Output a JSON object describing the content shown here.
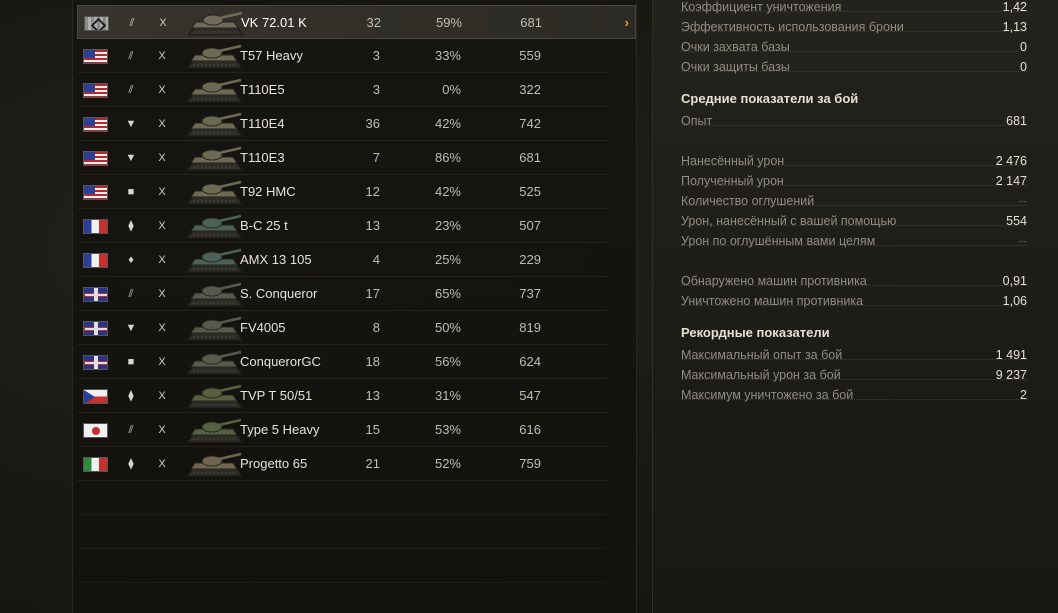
{
  "vehicles": [
    {
      "flag": "germany",
      "class": "heavy",
      "class_glyph": "⫽",
      "tier": "X",
      "name": "VK 72.01 K",
      "battles": "32",
      "winrate": "59%",
      "avg_exp": "681",
      "selected": true,
      "tank_color": "#6f6a5c"
    },
    {
      "flag": "usa",
      "class": "heavy",
      "class_glyph": "⫽",
      "tier": "X",
      "name": "T57 Heavy",
      "battles": "3",
      "winrate": "33%",
      "avg_exp": "559",
      "selected": false,
      "tank_color": "#6b6a52"
    },
    {
      "flag": "usa",
      "class": "heavy",
      "class_glyph": "⫽",
      "tier": "X",
      "name": "T110E5",
      "battles": "3",
      "winrate": "0%",
      "avg_exp": "322",
      "selected": false,
      "tank_color": "#6b6a52"
    },
    {
      "flag": "usa",
      "class": "td",
      "class_glyph": "▼",
      "tier": "X",
      "name": "T110E4",
      "battles": "36",
      "winrate": "42%",
      "avg_exp": "742",
      "selected": false,
      "tank_color": "#6b6a52"
    },
    {
      "flag": "usa",
      "class": "td",
      "class_glyph": "▼",
      "tier": "X",
      "name": "T110E3",
      "battles": "7",
      "winrate": "86%",
      "avg_exp": "681",
      "selected": false,
      "tank_color": "#6b6a52"
    },
    {
      "flag": "usa",
      "class": "spg",
      "class_glyph": "■",
      "tier": "X",
      "name": "T92 HMC",
      "battles": "12",
      "winrate": "42%",
      "avg_exp": "525",
      "selected": false,
      "tank_color": "#6b6a52"
    },
    {
      "flag": "france",
      "class": "medium",
      "class_glyph": "⧫",
      "tier": "X",
      "name": "B-C 25 t",
      "battles": "13",
      "winrate": "23%",
      "avg_exp": "507",
      "selected": false,
      "tank_color": "#4c6258"
    },
    {
      "flag": "france",
      "class": "light",
      "class_glyph": "♦",
      "tier": "X",
      "name": "AMX 13 105",
      "battles": "4",
      "winrate": "25%",
      "avg_exp": "229",
      "selected": false,
      "tank_color": "#4c6258"
    },
    {
      "flag": "uk",
      "class": "heavy",
      "class_glyph": "⫽",
      "tier": "X",
      "name": "S. Conqueror",
      "battles": "17",
      "winrate": "65%",
      "avg_exp": "737",
      "selected": false,
      "tank_color": "#5a5a4c"
    },
    {
      "flag": "uk",
      "class": "td",
      "class_glyph": "▼",
      "tier": "X",
      "name": "FV4005",
      "battles": "8",
      "winrate": "50%",
      "avg_exp": "819",
      "selected": false,
      "tank_color": "#5a5a4c"
    },
    {
      "flag": "uk",
      "class": "spg",
      "class_glyph": "■",
      "tier": "X",
      "name": "ConquerorGC",
      "battles": "18",
      "winrate": "56%",
      "avg_exp": "624",
      "selected": false,
      "tank_color": "#5a5a4c"
    },
    {
      "flag": "czech",
      "class": "medium",
      "class_glyph": "⧫",
      "tier": "X",
      "name": "TVP T 50/51",
      "battles": "13",
      "winrate": "31%",
      "avg_exp": "547",
      "selected": false,
      "tank_color": "#58603f"
    },
    {
      "flag": "japan",
      "class": "heavy",
      "class_glyph": "⫽",
      "tier": "X",
      "name": "Type 5 Heavy",
      "battles": "15",
      "winrate": "53%",
      "avg_exp": "616",
      "selected": false,
      "tank_color": "#55623f"
    },
    {
      "flag": "italy",
      "class": "medium",
      "class_glyph": "⧫",
      "tier": "X",
      "name": "Progetto 65",
      "battles": "21",
      "winrate": "52%",
      "avg_exp": "759",
      "selected": false,
      "tank_color": "#6e6450"
    }
  ],
  "stats": {
    "top_rows": [
      {
        "label": "Коэффициент уничтожения",
        "value": "1,42"
      },
      {
        "label": "Эффективность использования брони",
        "value": "1,13"
      },
      {
        "label": "Очки захвата базы",
        "value": "0"
      },
      {
        "label": "Очки защиты базы",
        "value": "0"
      }
    ],
    "avg_title": "Средние показатели за бой",
    "avg_exp": {
      "label": "Опыт",
      "value": "681"
    },
    "damage_rows": [
      {
        "label": "Нанесённый урон",
        "value": "2 476",
        "dim": false
      },
      {
        "label": "Полученный урон",
        "value": "2 147",
        "dim": false
      },
      {
        "label": "Количество оглушений",
        "value": "--",
        "dim": true
      },
      {
        "label": "Урон, нанесённый с вашей помощью",
        "value": "554",
        "dim": false
      },
      {
        "label": "Урон по оглушённым вами целям",
        "value": "--",
        "dim": true
      }
    ],
    "enemy_rows": [
      {
        "label": "Обнаружено машин противника",
        "value": "0,91"
      },
      {
        "label": "Уничтожено машин противника",
        "value": "1,06"
      }
    ],
    "record_title": "Рекордные показатели",
    "record_rows": [
      {
        "label": "Максимальный опыт за бой",
        "value": "1 491"
      },
      {
        "label": "Максимальный урон за бой",
        "value": "9 237"
      },
      {
        "label": "Максимум уничтожено за бой",
        "value": "2"
      }
    ]
  },
  "selected_chevron": "›"
}
